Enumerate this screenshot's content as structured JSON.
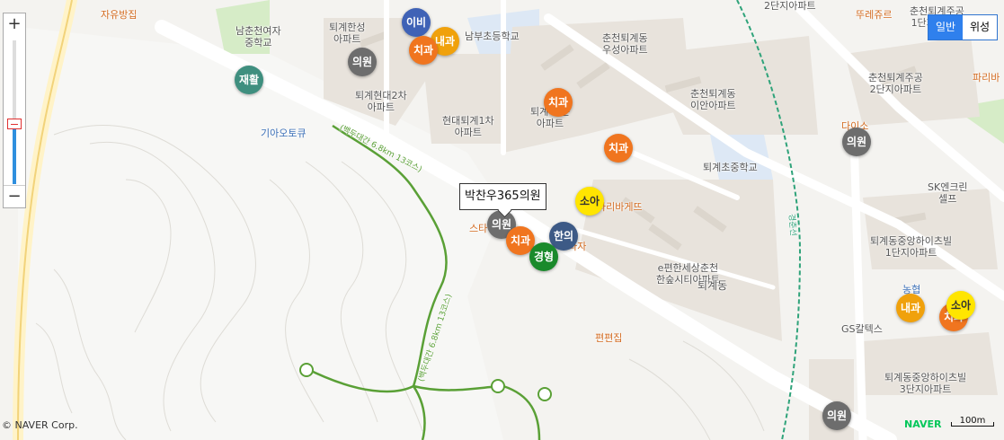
{
  "map": {
    "labels": {
      "jayu": "자유방집",
      "namchuncheon_school": "남춘천여자\n중학교",
      "toegye_hansung": "퇴계한성\n아파트",
      "nambu_school": "남부초등학교",
      "chuncheon_woosung": "춘천퇴계동\n우성아파트",
      "chuncheon_gyesuk": "춘천퇴계주공\n1단지아파트",
      "jugong2": "2단지아파트",
      "ttoraejureu": "뚜레쥬르",
      "toegye_hyundai2": "퇴계현대2차\n아파트",
      "hyundai_toegye1": "현대퇴계1차\n아파트",
      "toegye_town": "퇴계 타운\n아파트",
      "iansuk": "춘천퇴계동\n이안아파트",
      "jugong2_full": "춘천퇴계주공\n2단지아파트",
      "paris": "파리바",
      "kia": "기아오토큐",
      "daiso": "다이소",
      "toegye_elem": "퇴계초중학교",
      "sk": "SK엔크린\n셀프",
      "paris_baguette": "파리바게뜨",
      "hyosung": "퇴계동중앙하이츠빌\n1단지아파트",
      "st": "스타",
      "plaza": "프라자",
      "ehyeon": "e편한세상춘천\n한숲시티아파트",
      "toegye_dong": "퇴계동",
      "nonghyup": "농협",
      "gs": "GS칼텍스",
      "pyeonpyeon": "편편집",
      "hyosung3": "퇴계동중앙하이츠빌\n3단지아파트",
      "trail_upper": "(백두대간 6.8km 13코스)",
      "trail_lower": "(백두대간 6.8km 13코스)",
      "rail": "경춘선"
    },
    "markers": {
      "ibi": "이비",
      "chigwa1": "치과",
      "naegwa1": "내과",
      "uiwon1": "의원",
      "jaehwal": "재활",
      "chigwa2": "치과",
      "chigwa3": "치과",
      "soa1": "소아",
      "uiwon2": "의원",
      "chigwa4": "치과",
      "hanui": "한의",
      "jeonghyeong": "경형",
      "uiwon3": "의원",
      "naegwa2": "내과",
      "chigwa5": "치과",
      "soa2": "소아",
      "uiwon4": "의원"
    },
    "tooltip": "박찬우365의원"
  },
  "controls": {
    "zoom_in": "+",
    "zoom_out": "−",
    "zoom_level_fraction": 0.42,
    "maptype_normal": "일반",
    "maptype_satellite": "위성",
    "scale": "100m",
    "naver_logo": "NAVER",
    "copyright": "© NAVER Corp."
  },
  "colors": {
    "road": "#ffffff",
    "trail": "#5aa036",
    "rail": "#2fa37a",
    "highlight": "#2f80ed"
  }
}
